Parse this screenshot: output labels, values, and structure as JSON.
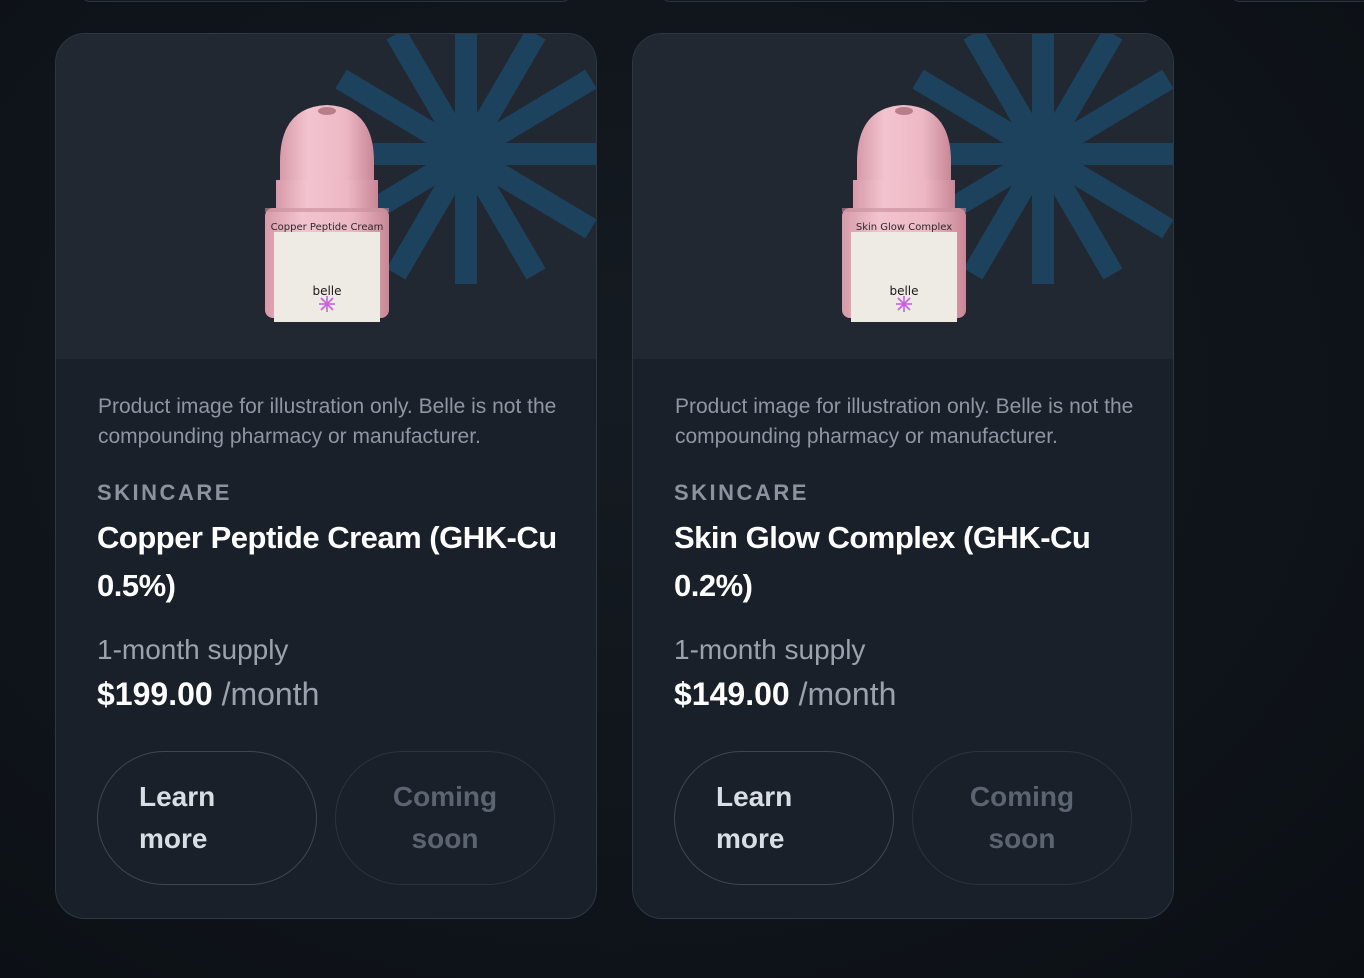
{
  "products": [
    {
      "jar_label": "Copper Peptide Cream",
      "jar_brand": "belle",
      "disclaimer": "Product image for illustration only. Belle is not the compounding pharmacy or manufacturer.",
      "category": "SKINCARE",
      "title": "Copper Peptide Cream (GHK-Cu 0.5%)",
      "supply": "1-month supply",
      "price": "$199.00",
      "price_unit": "/month",
      "learn_more": "Learn more",
      "coming_soon": "Coming soon"
    },
    {
      "jar_label": "Skin Glow Complex",
      "jar_brand": "belle",
      "disclaimer": "Product image for illustration only. Belle is not the compounding pharmacy or manufacturer.",
      "category": "SKINCARE",
      "title": "Skin Glow Complex (GHK-Cu 0.2%)",
      "supply": "1-month supply",
      "price": "$149.00",
      "price_unit": "/month",
      "learn_more": "Learn more",
      "coming_soon": "Coming soon"
    }
  ],
  "colors": {
    "background": "#0f141a",
    "card": "#1a2029",
    "image_panel": "#212832",
    "jar_pink": "#e8b4c0",
    "accent_star": "#c85fe0",
    "bg_star": "#1f4a6b"
  },
  "icons": {
    "brand_star": "asterisk-star-icon",
    "background_pattern": "asterisk-pattern-icon"
  }
}
